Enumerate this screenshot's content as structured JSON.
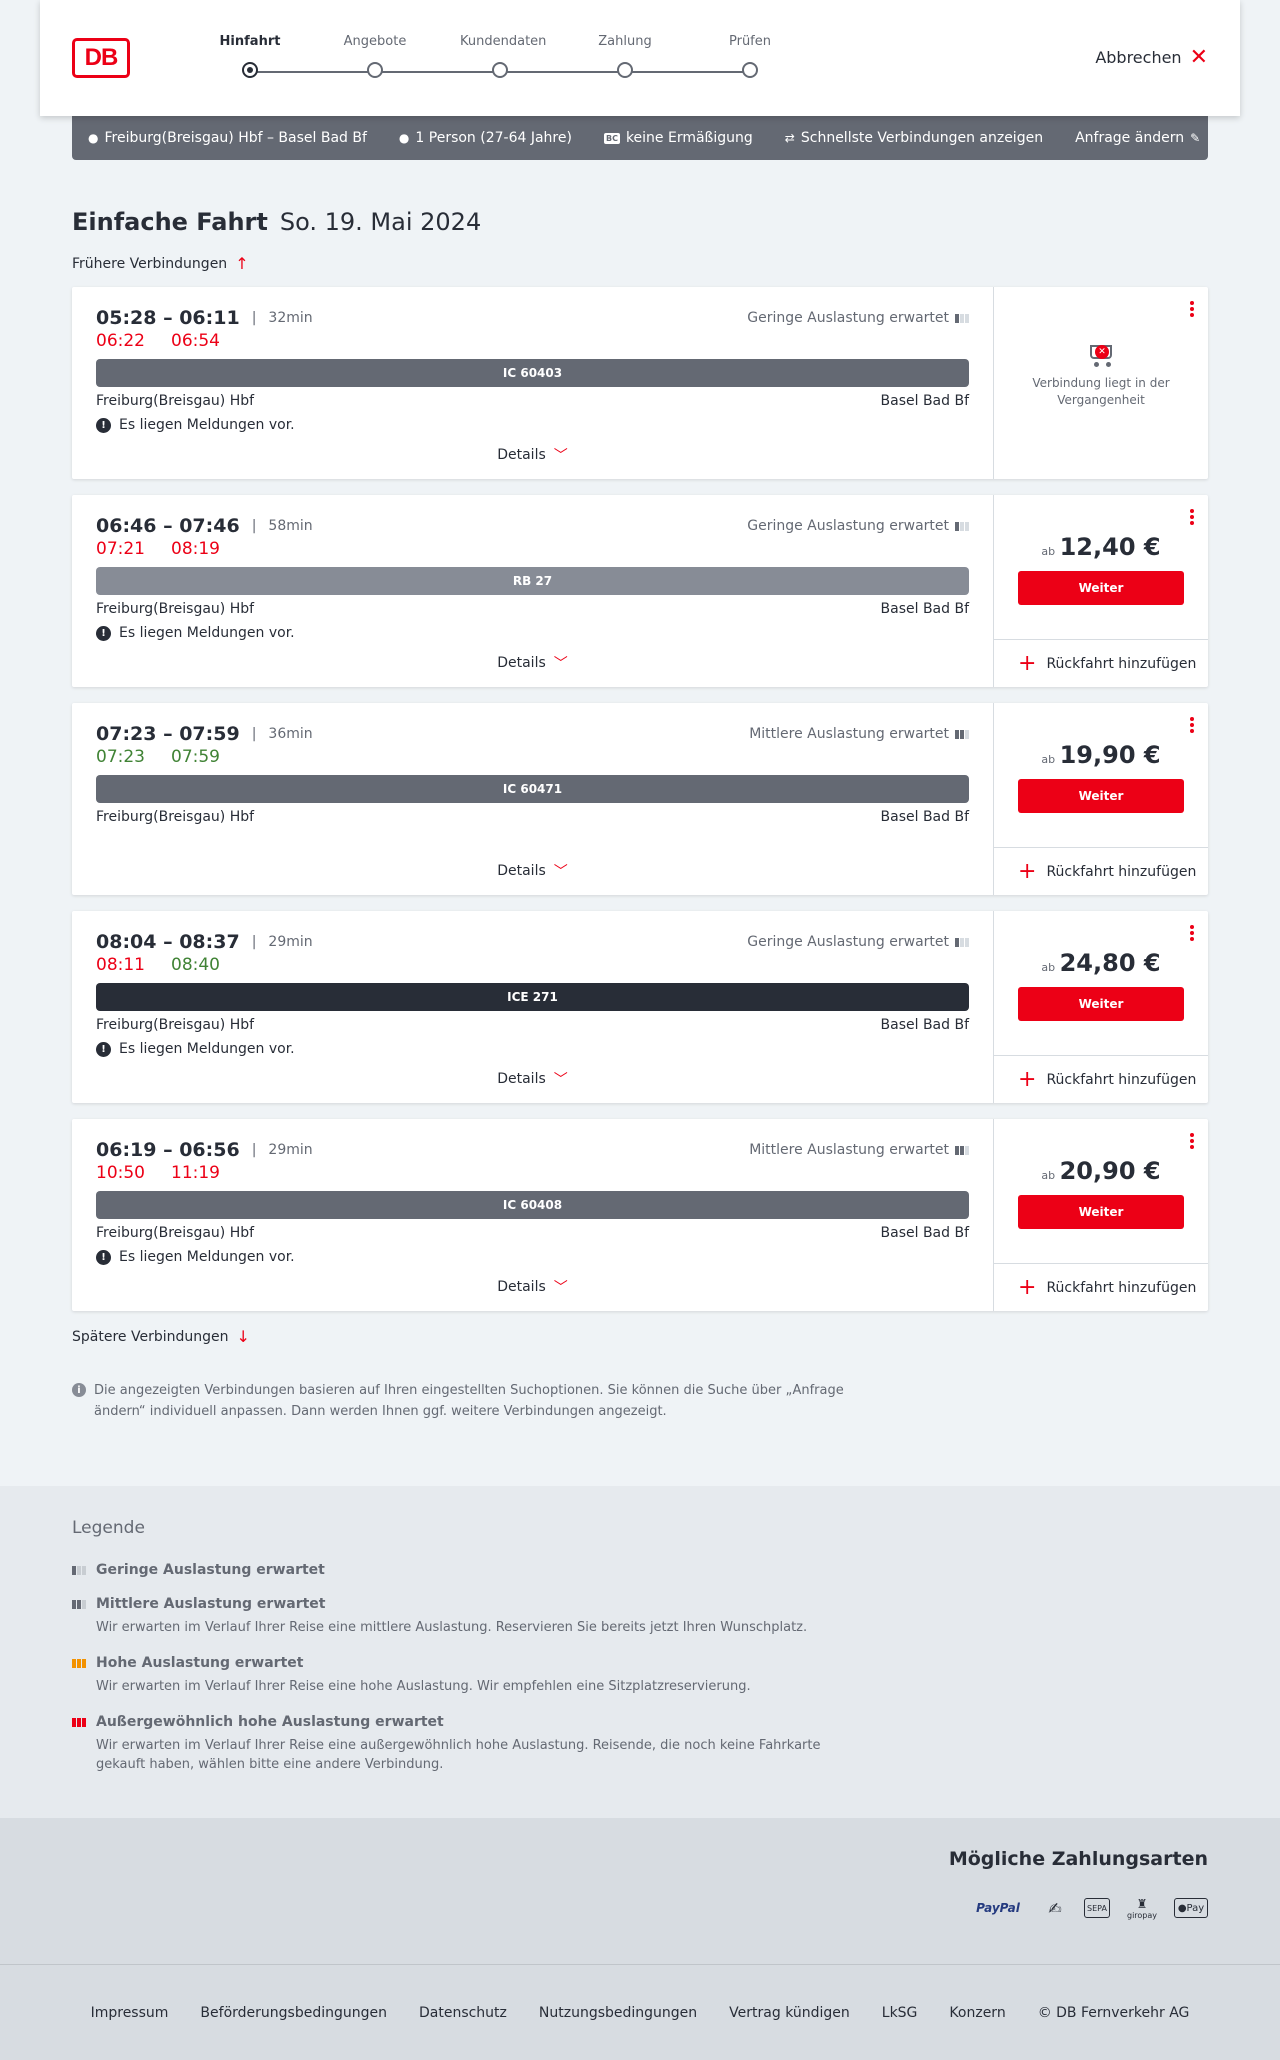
{
  "header": {
    "logo": "DB",
    "steps": [
      {
        "label": "Hinfahrt",
        "active": true
      },
      {
        "label": "Angebote",
        "active": false
      },
      {
        "label": "Kundendaten",
        "active": false
      },
      {
        "label": "Zahlung",
        "active": false
      },
      {
        "label": "Prüfen",
        "active": false
      }
    ],
    "cancel_label": "Abbrechen"
  },
  "summary": {
    "route": "Freiburg(Breisgau) Hbf – Basel Bad Bf",
    "travellers": "1 Person (27-64 Jahre)",
    "discount_badge": "BC",
    "discount": "keine Ermäßigung",
    "fastest": "Schnellste Verbindungen anzeigen",
    "edit": "Anfrage ändern"
  },
  "title": {
    "main": "Einfache Fahrt",
    "date": "So. 19. Mai 2024"
  },
  "earlier_label": "Frühere Verbindungen",
  "later_label": "Spätere Verbindungen",
  "colors": {
    "accent": "#ec0016",
    "late": "#ec0016",
    "ontime": "#408335",
    "bar_ic": "#646973",
    "bar_rb": "#878c96",
    "bar_ice": "#282d37"
  },
  "connections": [
    {
      "times": "05:28 – 06:11",
      "duration": "32min",
      "load": "Geringe Auslastung erwartet",
      "load_level": 1,
      "rt_dep": "06:22",
      "rt_dep_status": "late",
      "rt_arr": "06:54",
      "rt_arr_status": "late",
      "train": "IC 60403",
      "bar": "ic",
      "from": "Freiburg(Breisgau) Hbf",
      "to": "Basel Bad Bf",
      "message": "Es liegen Meldungen vor.",
      "details": "Details",
      "past": true,
      "past_text": "Verbindung liegt in der Vergangenheit"
    },
    {
      "times": "06:46 – 07:46",
      "duration": "58min",
      "load": "Geringe Auslastung erwartet",
      "load_level": 1,
      "rt_dep": "07:21",
      "rt_dep_status": "late",
      "rt_arr": "08:19",
      "rt_arr_status": "late",
      "train": "RB 27",
      "bar": "rb",
      "from": "Freiburg(Breisgau) Hbf",
      "to": "Basel Bad Bf",
      "message": "Es liegen Meldungen vor.",
      "details": "Details",
      "past": false,
      "price_prefix": "ab",
      "price": "12,40 €",
      "button": "Weiter",
      "return": "Rückfahrt hinzufügen"
    },
    {
      "times": "07:23 – 07:59",
      "duration": "36min",
      "load": "Mittlere Auslastung erwartet",
      "load_level": 2,
      "rt_dep": "07:23",
      "rt_dep_status": "ontime",
      "rt_arr": "07:59",
      "rt_arr_status": "ontime",
      "train": "IC 60471",
      "bar": "ic",
      "from": "Freiburg(Breisgau) Hbf",
      "to": "Basel Bad Bf",
      "message": "",
      "details": "Details",
      "past": false,
      "price_prefix": "ab",
      "price": "19,90 €",
      "button": "Weiter",
      "return": "Rückfahrt hinzufügen"
    },
    {
      "times": "08:04 – 08:37",
      "duration": "29min",
      "load": "Geringe Auslastung erwartet",
      "load_level": 1,
      "rt_dep": "08:11",
      "rt_dep_status": "late",
      "rt_arr": "08:40",
      "rt_arr_status": "ontime",
      "train": "ICE 271",
      "bar": "ice",
      "from": "Freiburg(Breisgau) Hbf",
      "to": "Basel Bad Bf",
      "message": "Es liegen Meldungen vor.",
      "details": "Details",
      "past": false,
      "price_prefix": "ab",
      "price": "24,80 €",
      "button": "Weiter",
      "return": "Rückfahrt hinzufügen"
    },
    {
      "times": "06:19 – 06:56",
      "duration": "29min",
      "load": "Mittlere Auslastung erwartet",
      "load_level": 2,
      "rt_dep": "10:50",
      "rt_dep_status": "late",
      "rt_arr": "11:19",
      "rt_arr_status": "late",
      "train": "IC 60408",
      "bar": "ic",
      "from": "Freiburg(Breisgau) Hbf",
      "to": "Basel Bad Bf",
      "message": "Es liegen Meldungen vor.",
      "details": "Details",
      "past": false,
      "price_prefix": "ab",
      "price": "20,90 €",
      "button": "Weiter",
      "return": "Rückfahrt hinzufügen"
    }
  ],
  "info": "Die angezeigten Verbindungen basieren auf Ihren eingestellten Suchoptionen. Sie können die Suche über „Anfrage ändern“ individuell anpassen. Dann werden Ihnen ggf. weitere Verbindungen angezeigt.",
  "legend": {
    "title": "Legende",
    "items": [
      {
        "label": "Geringe Auslastung erwartet",
        "desc": "",
        "level": 1,
        "color": "gray"
      },
      {
        "label": "Mittlere Auslastung erwartet",
        "desc": "Wir erwarten im Verlauf Ihrer Reise eine mittlere Auslastung. Reservieren Sie bereits jetzt Ihren Wunschplatz.",
        "level": 2,
        "color": "gray"
      },
      {
        "label": "Hohe Auslastung erwartet",
        "desc": "Wir erwarten im Verlauf Ihrer Reise eine hohe Auslastung. Wir empfehlen eine Sitzplatzreservierung.",
        "level": 3,
        "color": "orange"
      },
      {
        "label": "Außergewöhnlich hohe Auslastung erwartet",
        "desc": "Wir erwarten im Verlauf Ihrer Reise eine außergewöhnlich hohe Auslastung. Reisende, die noch keine Fahrkarte gekauft haben, wählen bitte eine andere Verbindung.",
        "level": 4,
        "color": "red"
      }
    ]
  },
  "payment": {
    "title": "Mögliche Zahlungsarten",
    "methods": [
      "PayPal",
      "sepa-direct-debit",
      "SEPA",
      "giropay",
      "Pay"
    ]
  },
  "footer": {
    "links": [
      "Impressum",
      "Beförderungsbedingungen",
      "Datenschutz",
      "Nutzungsbedingungen",
      "Vertrag kündigen",
      "LkSG",
      "Konzern",
      "© DB Fernverkehr AG"
    ]
  }
}
